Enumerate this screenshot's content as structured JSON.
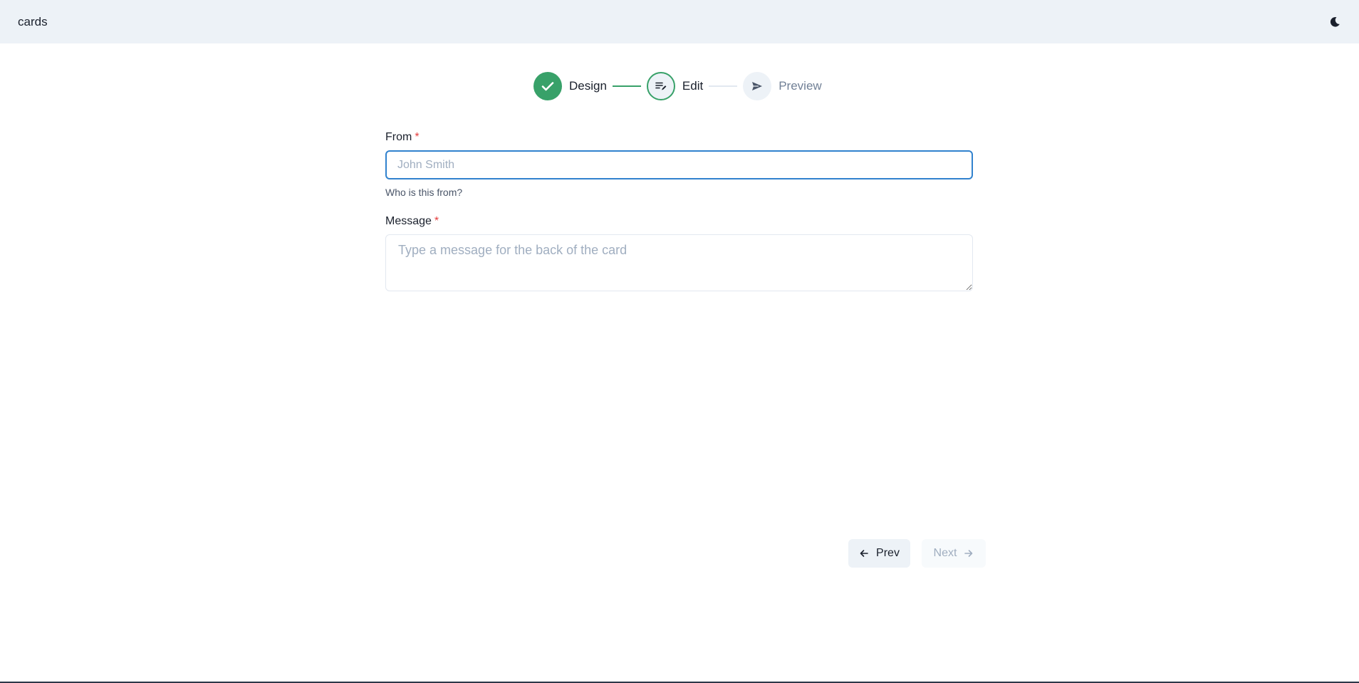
{
  "header": {
    "brand": "cards",
    "theme_toggle_icon": "moon-icon"
  },
  "stepper": {
    "steps": [
      {
        "label": "Design",
        "state": "done",
        "icon": "check-icon"
      },
      {
        "label": "Edit",
        "state": "active",
        "icon": "edit-lines-icon"
      },
      {
        "label": "Preview",
        "state": "todo",
        "icon": "send-icon"
      }
    ]
  },
  "form": {
    "from": {
      "label": "From",
      "required_mark": "*",
      "placeholder": "John Smith",
      "value": "",
      "helper": "Who is this from?"
    },
    "message": {
      "label": "Message",
      "required_mark": "*",
      "placeholder": "Type a message for the back of the card",
      "value": ""
    }
  },
  "nav": {
    "prev_label": "Prev",
    "next_label": "Next"
  },
  "colors": {
    "accent": "#38a169",
    "focus": "#3182ce",
    "required": "#e53e3e",
    "topbar_bg": "#edf2f7"
  }
}
